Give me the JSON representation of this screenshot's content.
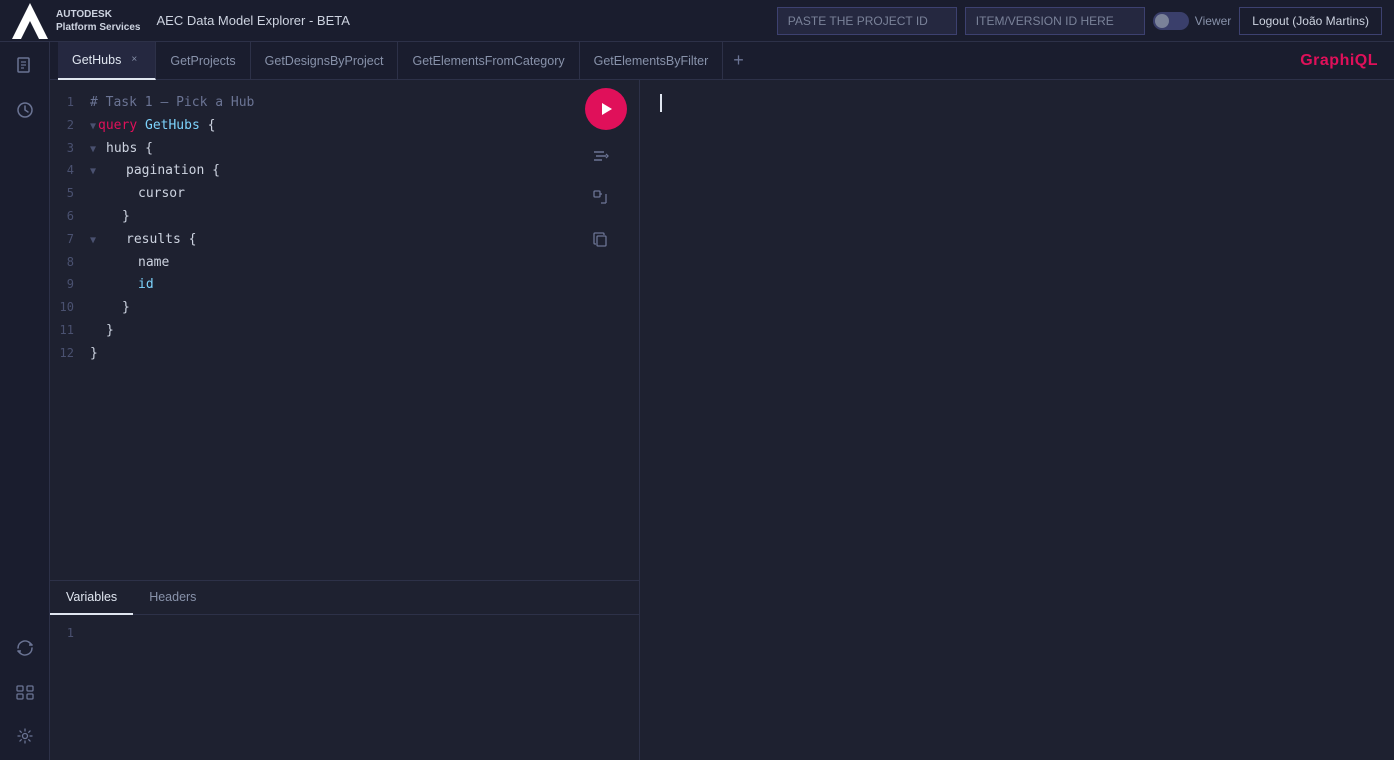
{
  "header": {
    "logo_line1": "AUTODESK",
    "logo_line2": "Platform Services",
    "app_title": "AEC Data Model Explorer - BETA",
    "project_id_placeholder": "PASTE THE PROJECT ID",
    "version_id_placeholder": "ITEM/VERSION ID HERE",
    "viewer_label": "Viewer",
    "logout_label": "Logout (João Martins)"
  },
  "tabs": [
    {
      "id": "GetHubs",
      "label": "GetHubs",
      "active": true,
      "closeable": true
    },
    {
      "id": "GetProjects",
      "label": "GetProjects",
      "active": false,
      "closeable": false
    },
    {
      "id": "GetDesignsByProject",
      "label": "GetDesignsByProject",
      "active": false,
      "closeable": false
    },
    {
      "id": "GetElementsFromCategory",
      "label": "GetElementsFromCategory",
      "active": false,
      "closeable": false
    },
    {
      "id": "GetElementsByFilter",
      "label": "GetElementsByFilter",
      "active": false,
      "closeable": false
    }
  ],
  "graphiql_label": "GraphiQL",
  "editor": {
    "lines": [
      {
        "num": 1,
        "tokens": [
          {
            "type": "comment",
            "text": "# Task 1 – Pick a Hub"
          }
        ]
      },
      {
        "num": 2,
        "tokens": [
          {
            "type": "keyword",
            "text": "query"
          },
          {
            "type": "space",
            "text": " "
          },
          {
            "type": "function",
            "text": "GetHubs"
          },
          {
            "type": "space",
            "text": " "
          },
          {
            "type": "brace",
            "text": "{"
          }
        ],
        "collapse": true
      },
      {
        "num": 3,
        "tokens": [
          {
            "type": "space",
            "text": "    "
          },
          {
            "type": "field",
            "text": "hubs"
          },
          {
            "type": "space",
            "text": " "
          },
          {
            "type": "brace",
            "text": "{"
          }
        ],
        "collapse": true
      },
      {
        "num": 4,
        "tokens": [
          {
            "type": "space",
            "text": "        "
          },
          {
            "type": "field",
            "text": "pagination"
          },
          {
            "type": "space",
            "text": " "
          },
          {
            "type": "brace",
            "text": "{"
          }
        ],
        "collapse": true
      },
      {
        "num": 5,
        "tokens": [
          {
            "type": "space",
            "text": "            "
          },
          {
            "type": "field",
            "text": "cursor"
          }
        ]
      },
      {
        "num": 6,
        "tokens": [
          {
            "type": "space",
            "text": "        "
          },
          {
            "type": "brace",
            "text": "}"
          }
        ]
      },
      {
        "num": 7,
        "tokens": [
          {
            "type": "space",
            "text": "        "
          },
          {
            "type": "field",
            "text": "results"
          },
          {
            "type": "space",
            "text": " "
          },
          {
            "type": "brace",
            "text": "{"
          }
        ],
        "collapse": true
      },
      {
        "num": 8,
        "tokens": [
          {
            "type": "space",
            "text": "            "
          },
          {
            "type": "field",
            "text": "name"
          }
        ]
      },
      {
        "num": 9,
        "tokens": [
          {
            "type": "space",
            "text": "            "
          },
          {
            "type": "type",
            "text": "id"
          }
        ]
      },
      {
        "num": 10,
        "tokens": [
          {
            "type": "space",
            "text": "        "
          },
          {
            "type": "brace",
            "text": "}"
          }
        ]
      },
      {
        "num": 11,
        "tokens": [
          {
            "type": "space",
            "text": "    "
          },
          {
            "type": "brace",
            "text": "}"
          }
        ]
      },
      {
        "num": 12,
        "tokens": [
          {
            "type": "brace",
            "text": "}"
          }
        ]
      }
    ]
  },
  "variables_tabs": [
    {
      "label": "Variables",
      "active": true
    },
    {
      "label": "Headers",
      "active": false
    }
  ],
  "variables_line_num": "1",
  "sidebar_icons": [
    {
      "name": "docs-icon",
      "glyph": "📄"
    },
    {
      "name": "history-icon",
      "glyph": "🕐"
    }
  ],
  "sidebar_bottom_icons": [
    {
      "name": "refresh-icon",
      "glyph": "↻"
    },
    {
      "name": "shortcut-icon",
      "glyph": "⌘"
    },
    {
      "name": "settings-icon",
      "glyph": "⚙"
    }
  ]
}
